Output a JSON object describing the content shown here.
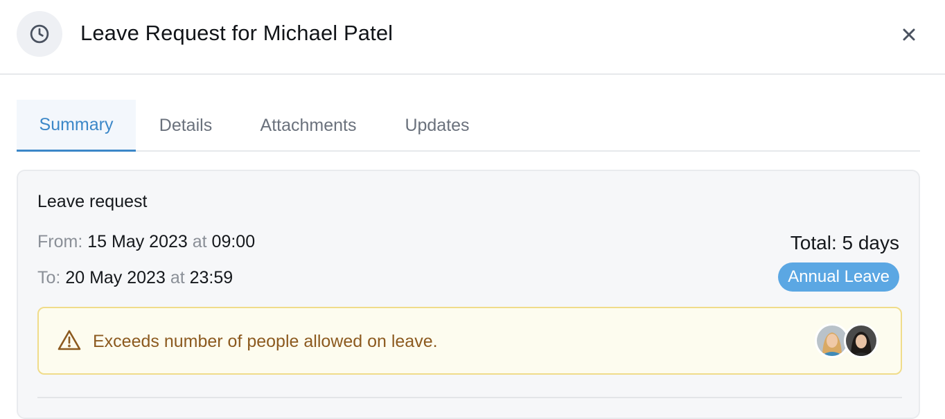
{
  "header": {
    "icon": "clock-icon",
    "title_prefix": "Leave Request for ",
    "title_name": "Michael Patel",
    "close_icon": "close-icon"
  },
  "tabs": [
    {
      "label": "Summary",
      "active": true
    },
    {
      "label": "Details",
      "active": false
    },
    {
      "label": "Attachments",
      "active": false
    },
    {
      "label": "Updates",
      "active": false
    }
  ],
  "request": {
    "title": "Leave request",
    "from_label": "From:",
    "from_date": "15 May 2023",
    "at_word": "at",
    "from_time": "09:00",
    "to_label": "To:",
    "to_date": "20 May 2023",
    "to_time": "23:59",
    "total": "Total: 5 days",
    "leave_type": "Annual Leave"
  },
  "warning": {
    "icon": "warning-triangle-icon",
    "text": "Exceeds number of people allowed on leave.",
    "avatars": [
      "avatar-1",
      "avatar-2"
    ]
  },
  "colors": {
    "accent": "#3b87c8",
    "badge": "#5ba7e3",
    "warning_text": "#8c5a1f",
    "warning_border": "#f0dc8a",
    "warning_bg": "#fdfcef"
  }
}
